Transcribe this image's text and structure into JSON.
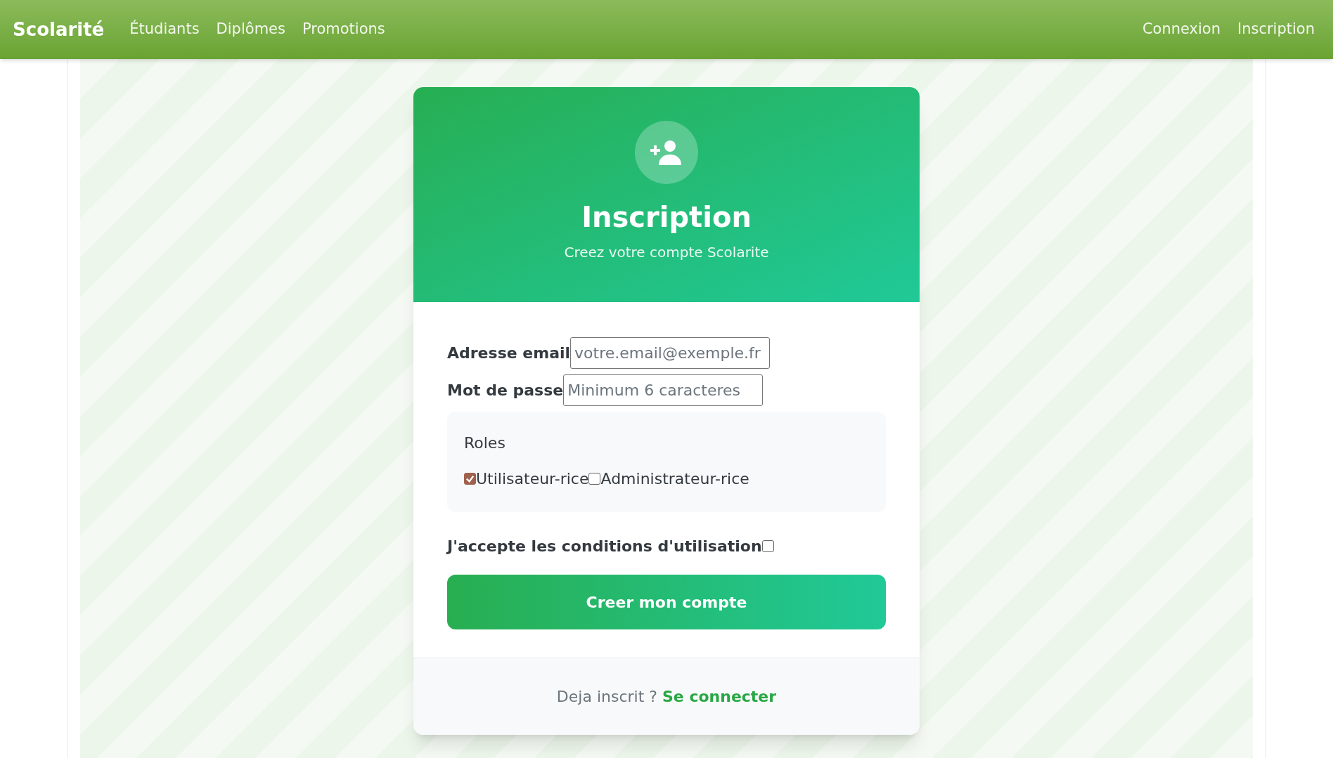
{
  "navbar": {
    "brand": "Scolarité",
    "links": [
      {
        "label": "Étudiants"
      },
      {
        "label": "Diplômes"
      },
      {
        "label": "Promotions"
      }
    ],
    "right_links": [
      {
        "label": "Connexion"
      },
      {
        "label": "Inscription"
      }
    ]
  },
  "card": {
    "title": "Inscription",
    "subtitle": "Creez votre compte Scolarite",
    "fields": [
      {
        "label": "Adresse email",
        "placeholder": "votre.email@exemple.fr"
      },
      {
        "label": "Mot de passe",
        "placeholder": "Minimum 6 caracteres"
      }
    ],
    "roles": {
      "title": "Roles",
      "options": [
        {
          "label": "Utilisateur-rice",
          "checked": true
        },
        {
          "label": "Administrateur-rice",
          "checked": false
        }
      ]
    },
    "terms": {
      "label": "J'accepte les conditions d'utilisation",
      "checked": false
    },
    "submit": "Creer mon compte",
    "footer": {
      "text": "Deja inscrit ?",
      "link": "Se connecter"
    }
  }
}
